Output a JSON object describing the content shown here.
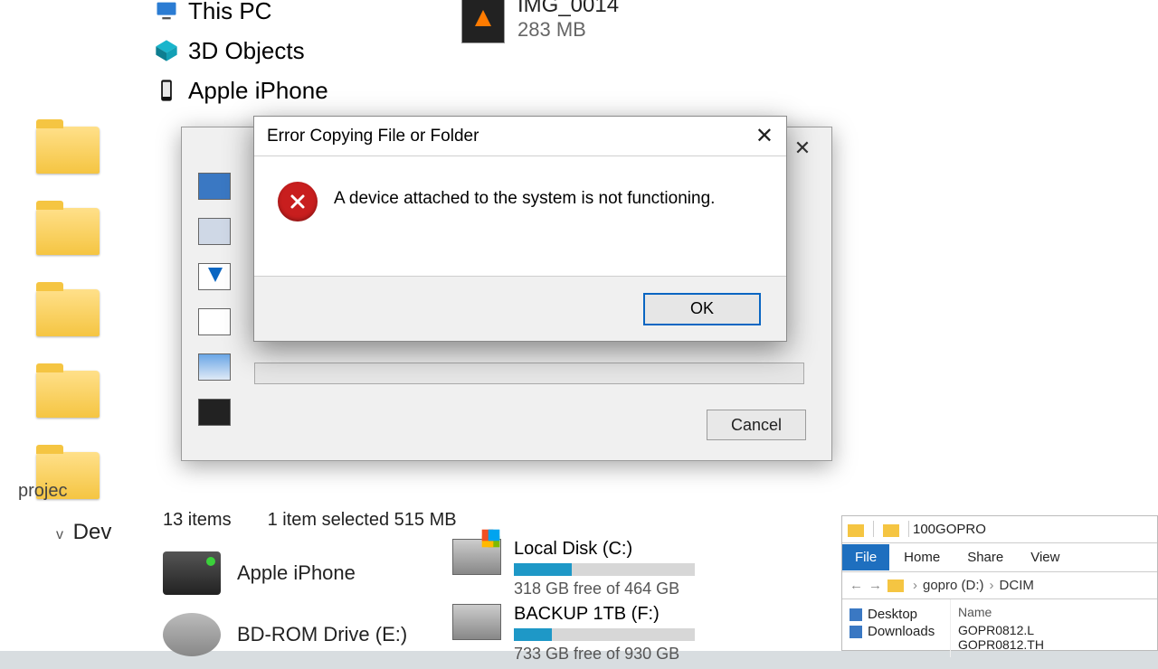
{
  "nav": {
    "this_pc": "This PC",
    "objects_3d": "3D Objects",
    "iphone": "Apple iPhone"
  },
  "file": {
    "name": "IMG_0014",
    "size": "283 MB"
  },
  "progress": {
    "cancel": "Cancel"
  },
  "error": {
    "title": "Error Copying File or Folder",
    "message": "A device attached to the system is not functioning.",
    "ok": "OK"
  },
  "status": {
    "items": "13 items",
    "selected": "1 item selected  515 MB"
  },
  "left_labels": {
    "proj": "projec",
    "dev": "Dev"
  },
  "devices": {
    "iphone": "Apple iPhone",
    "bdrom": "BD-ROM Drive (E:)"
  },
  "disks": {
    "c": {
      "name": "Local Disk (C:)",
      "free": "318 GB free of 464 GB",
      "pct": 32
    },
    "f": {
      "name": "BACKUP 1TB (F:)",
      "free": "733 GB free of 930 GB",
      "pct": 21
    }
  },
  "mini": {
    "title": "100GOPRO",
    "tabs": {
      "file": "File",
      "home": "Home",
      "share": "Share",
      "view": "View"
    },
    "crumb": {
      "drive": "gopro (D:)",
      "folder": "DCIM"
    },
    "side": {
      "desktop": "Desktop",
      "downloads": "Downloads"
    },
    "list": {
      "header": "Name",
      "f1": "GOPR0812.L",
      "f2": "GOPR0812.TH"
    }
  }
}
